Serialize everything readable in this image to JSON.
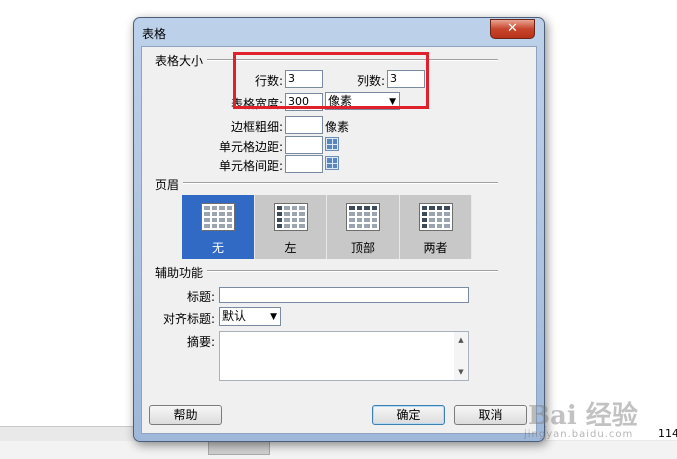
{
  "dialog": {
    "title": "表格",
    "close_symbol": "✕"
  },
  "size_section": {
    "title": "表格大小",
    "rows_label": "行数:",
    "rows_value": "3",
    "cols_label": "列数:",
    "cols_value": "3",
    "width_label": "表格宽度:",
    "width_value": "300",
    "width_unit": "像素",
    "border_label": "边框粗细:",
    "border_value": "",
    "border_unit": "像素",
    "padding_label": "单元格边距:",
    "padding_value": "",
    "spacing_label": "单元格间距:",
    "spacing_value": ""
  },
  "header_section": {
    "title": "页眉",
    "options": [
      {
        "label": "无",
        "selected": true
      },
      {
        "label": "左",
        "selected": false
      },
      {
        "label": "顶部",
        "selected": false
      },
      {
        "label": "两者",
        "selected": false
      }
    ]
  },
  "accessibility": {
    "title": "辅助功能",
    "caption_label": "标题:",
    "caption_value": "",
    "align_label": "对齐标题:",
    "align_value": "默认",
    "summary_label": "摘要:",
    "summary_value": ""
  },
  "buttons": {
    "help": "帮助",
    "ok": "确定",
    "cancel": "取消"
  },
  "background": {
    "status_number": "114",
    "watermark": "Bai 经验",
    "watermark_url": "jingyan.baidu.com"
  },
  "colors": {
    "selected": "#316ac5",
    "highlight_box": "#e0202a"
  }
}
